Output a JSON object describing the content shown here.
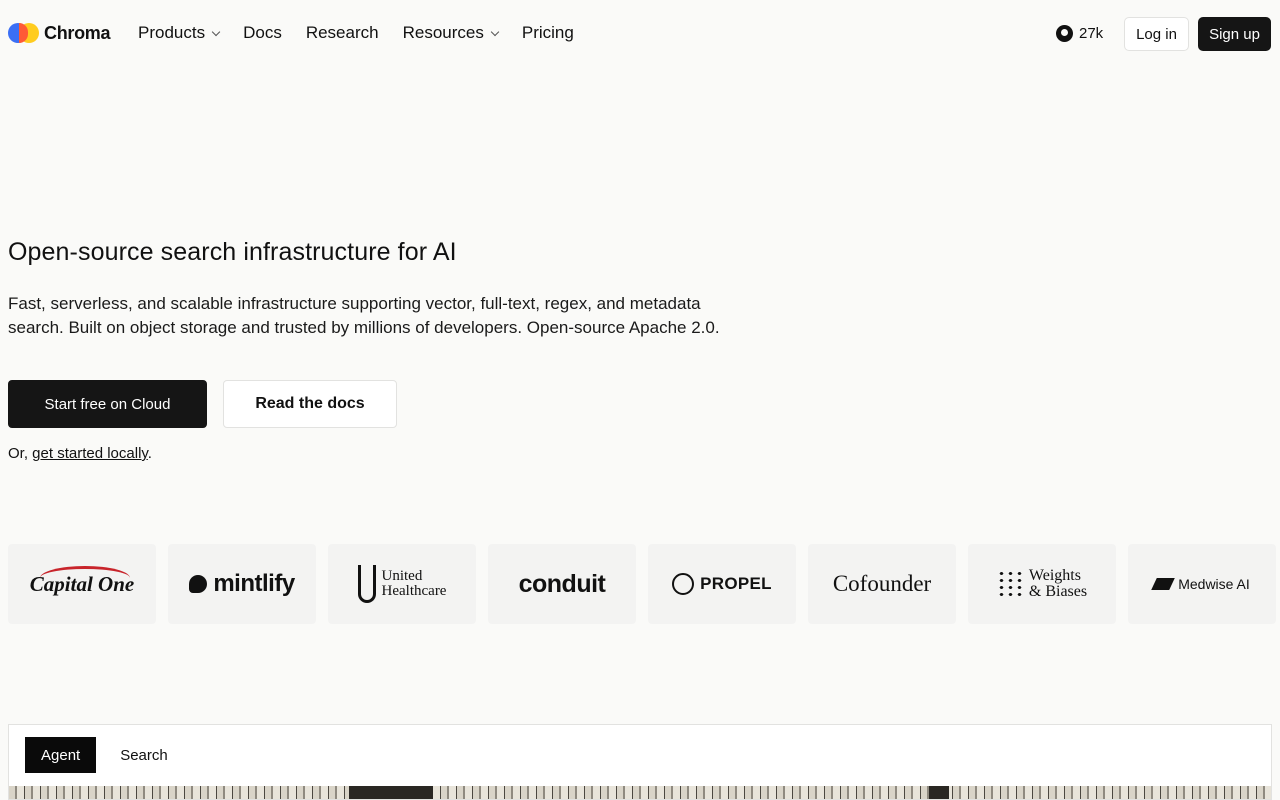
{
  "nav": {
    "brand": "Chroma",
    "menu": [
      "Products",
      "Docs",
      "Research",
      "Resources",
      "Pricing"
    ],
    "github_stars": "27k",
    "login": "Log in",
    "signup": "Sign up"
  },
  "hero": {
    "title": "Open-source search infrastructure for AI",
    "subtitle": "Fast, serverless, and scalable infrastructure supporting vector, full-text, regex, and metadata search. Built on object storage and trusted by millions of developers. Open-source Apache 2.0.",
    "primary_cta": "Start free on Cloud",
    "secondary_cta": "Read the docs",
    "local_prefix": "Or, ",
    "local_link": "get started locally",
    "local_suffix": "."
  },
  "customers": {
    "capital_one": "Capital One",
    "mintlify": "mintlify",
    "uh_line1": "United",
    "uh_line2": "Healthcare",
    "conduit": "conduit",
    "propel": "PROPEL",
    "cofounder": "Cofounder",
    "wb_line1": "Weights",
    "wb_line2": "& Biases",
    "medwise": "Medwise AI"
  },
  "demo": {
    "tabs": [
      "Agent",
      "Search"
    ],
    "active_tab": "Agent"
  },
  "colors": {
    "background": "#fafaf8",
    "primary_button": "#151515",
    "logo_blue": "#3b6ff5",
    "logo_yellow": "#ffcc1f",
    "logo_red": "#ff5a36"
  }
}
